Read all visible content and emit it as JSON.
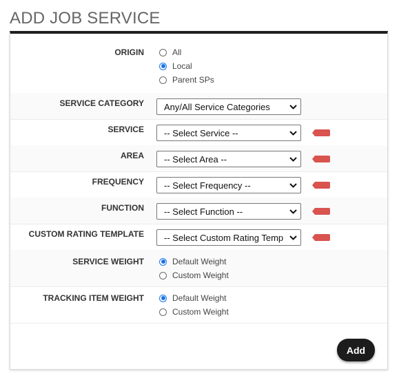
{
  "page": {
    "title": "ADD JOB SERVICE"
  },
  "origin": {
    "label": "ORIGIN",
    "options": [
      {
        "label": "All",
        "selected": false
      },
      {
        "label": "Local",
        "selected": true
      },
      {
        "label": "Parent SPs",
        "selected": false
      }
    ]
  },
  "service_category": {
    "label": "SERVICE CATEGORY",
    "value": "Any/All Service Categories"
  },
  "service": {
    "label": "SERVICE",
    "value": "-- Select Service --",
    "required": true
  },
  "area": {
    "label": "AREA",
    "value": "-- Select Area --",
    "required": true
  },
  "frequency": {
    "label": "FREQUENCY",
    "value": "-- Select Frequency --",
    "required": true
  },
  "function": {
    "label": "FUNCTION",
    "value": "-- Select Function --",
    "required": true
  },
  "custom_rating_template": {
    "label": "CUSTOM RATING TEMPLATE",
    "value": "-- Select Custom Rating Temp",
    "required": true
  },
  "service_weight": {
    "label": "SERVICE WEIGHT",
    "options": [
      {
        "label": "Default Weight",
        "selected": true
      },
      {
        "label": "Custom Weight",
        "selected": false
      }
    ]
  },
  "tracking_item_weight": {
    "label": "TRACKING ITEM WEIGHT",
    "options": [
      {
        "label": "Default Weight",
        "selected": true
      },
      {
        "label": "Custom Weight",
        "selected": false
      }
    ]
  },
  "actions": {
    "add_label": "Add"
  },
  "colors": {
    "accent": "#1a73e8",
    "required_marker": "#d9534f",
    "panel_top_border": "#1f1f1f",
    "button_bg": "#1c1c1c"
  },
  "icons": {
    "select_arrow": "chevron-down-icon",
    "required_marker": "required-flag-icon"
  }
}
